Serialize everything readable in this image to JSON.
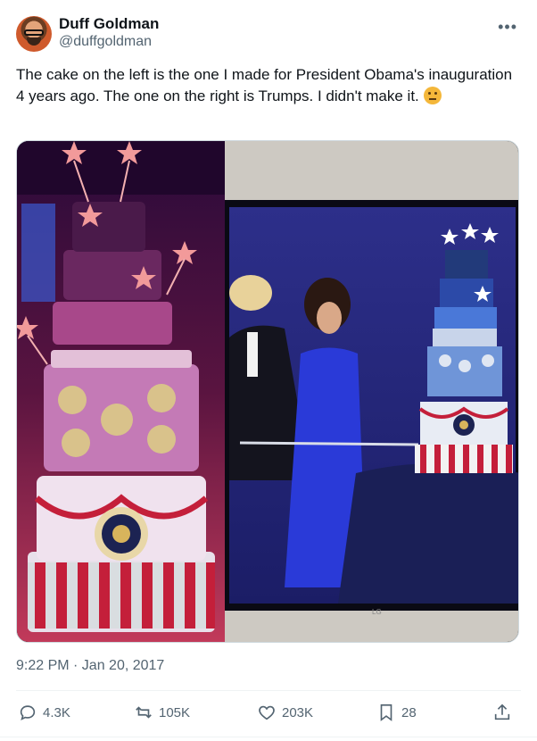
{
  "author": {
    "display_name": "Duff Goldman",
    "handle": "@duffgoldman"
  },
  "tweet": {
    "text": "The cake on the left is the one I made for President Obama's inauguration 4 years ago. The one on the right is Trumps. I didn't make it.",
    "emoji_icon": "thinking-face-icon",
    "timestamp": "9:22 PM · Jan 20, 2017"
  },
  "media": {
    "left_scene": "tiered-inauguration-cake-pink-lit",
    "right_scene": "tiered-inauguration-cake-blue-table-tv-photo",
    "tv_brand": "LG"
  },
  "actions": {
    "replies": "4.3K",
    "reposts": "105K",
    "likes": "203K",
    "bookmarks": "28"
  },
  "colors": {
    "text_primary": "#0f1419",
    "text_secondary": "#536471",
    "border": "#cfd9de"
  }
}
